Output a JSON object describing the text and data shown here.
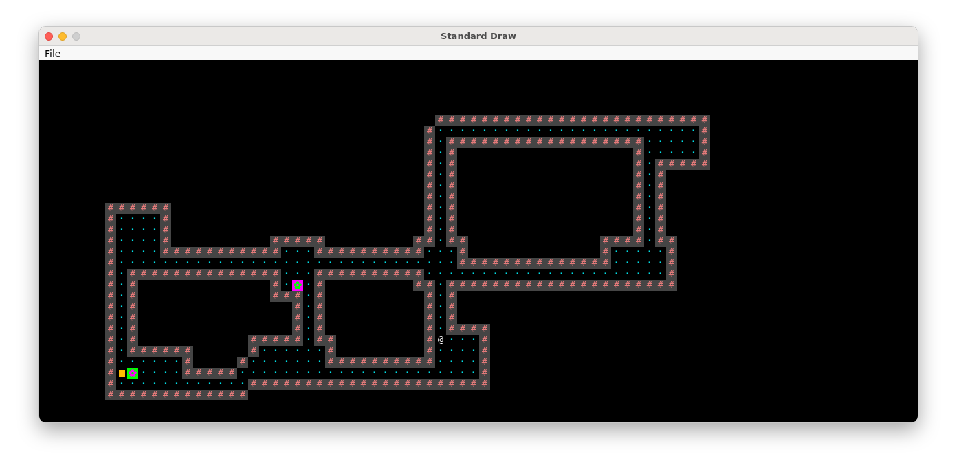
{
  "window": {
    "title": "Standard Draw"
  },
  "menu": [
    "File"
  ],
  "map_rows": [
    [
      {
        "kind": "gap",
        "text": "                              "
      },
      {
        "kind": "wall",
        "text": "# # # # # # # # # # # # # # # # # # # # # # # # #"
      }
    ],
    [
      {
        "kind": "gap",
        "text": "                             "
      },
      {
        "kind": "wall",
        "text": "#"
      },
      {
        "kind": "floor",
        "text": "· · · · · · · · · · · · · · · · · · · · · · · ·"
      },
      {
        "kind": "wall",
        "text": "#"
      }
    ],
    [
      {
        "kind": "gap",
        "text": "                             "
      },
      {
        "kind": "wall",
        "text": "#"
      },
      {
        "kind": "floor",
        "text": "·"
      },
      {
        "kind": "wall",
        "text": "# # # # # # # # # # # # # # # # # #"
      },
      {
        "kind": "floor",
        "text": "· · · · ·"
      },
      {
        "kind": "wall",
        "text": "#"
      }
    ],
    [
      {
        "kind": "gap",
        "text": "                             "
      },
      {
        "kind": "wall",
        "text": "#"
      },
      {
        "kind": "floor",
        "text": "·"
      },
      {
        "kind": "wall",
        "text": "#"
      },
      {
        "kind": "gap",
        "text": "                "
      },
      {
        "kind": "wall",
        "text": "#"
      },
      {
        "kind": "floor",
        "text": "· · · · ·"
      },
      {
        "kind": "wall",
        "text": "#"
      }
    ],
    [
      {
        "kind": "gap",
        "text": "                             "
      },
      {
        "kind": "wall",
        "text": "#"
      },
      {
        "kind": "floor",
        "text": "·"
      },
      {
        "kind": "wall",
        "text": "#"
      },
      {
        "kind": "gap",
        "text": "                "
      },
      {
        "kind": "wall",
        "text": "#"
      },
      {
        "kind": "floor",
        "text": "·"
      },
      {
        "kind": "wall",
        "text": "# # # # #"
      }
    ],
    [
      {
        "kind": "gap",
        "text": "                             "
      },
      {
        "kind": "wall",
        "text": "#"
      },
      {
        "kind": "floor",
        "text": "·"
      },
      {
        "kind": "wall",
        "text": "#"
      },
      {
        "kind": "gap",
        "text": "                "
      },
      {
        "kind": "wall",
        "text": "#"
      },
      {
        "kind": "floor",
        "text": "·"
      },
      {
        "kind": "wall",
        "text": "#"
      }
    ],
    [
      {
        "kind": "gap",
        "text": "                             "
      },
      {
        "kind": "wall",
        "text": "#"
      },
      {
        "kind": "floor",
        "text": "·"
      },
      {
        "kind": "wall",
        "text": "#"
      },
      {
        "kind": "gap",
        "text": "                "
      },
      {
        "kind": "wall",
        "text": "#"
      },
      {
        "kind": "floor",
        "text": "·"
      },
      {
        "kind": "wall",
        "text": "#"
      }
    ],
    [
      {
        "kind": "gap",
        "text": "                             "
      },
      {
        "kind": "wall",
        "text": "#"
      },
      {
        "kind": "floor",
        "text": "·"
      },
      {
        "kind": "wall",
        "text": "#"
      },
      {
        "kind": "gap",
        "text": "                "
      },
      {
        "kind": "wall",
        "text": "#"
      },
      {
        "kind": "floor",
        "text": "·"
      },
      {
        "kind": "wall",
        "text": "#"
      }
    ],
    [
      {
        "kind": "wall",
        "text": "# # # # # #"
      },
      {
        "kind": "gap",
        "text": "                       "
      },
      {
        "kind": "wall",
        "text": "#"
      },
      {
        "kind": "floor",
        "text": "·"
      },
      {
        "kind": "wall",
        "text": "#"
      },
      {
        "kind": "gap",
        "text": "                "
      },
      {
        "kind": "wall",
        "text": "#"
      },
      {
        "kind": "floor",
        "text": "·"
      },
      {
        "kind": "wall",
        "text": "#"
      }
    ],
    [
      {
        "kind": "wall",
        "text": "#"
      },
      {
        "kind": "floor",
        "text": "· · · ·"
      },
      {
        "kind": "wall",
        "text": "#"
      },
      {
        "kind": "gap",
        "text": "                       "
      },
      {
        "kind": "wall",
        "text": "#"
      },
      {
        "kind": "floor",
        "text": "·"
      },
      {
        "kind": "wall",
        "text": "#"
      },
      {
        "kind": "gap",
        "text": "                "
      },
      {
        "kind": "wall",
        "text": "#"
      },
      {
        "kind": "floor",
        "text": "·"
      },
      {
        "kind": "wall",
        "text": "#"
      }
    ],
    [
      {
        "kind": "wall",
        "text": "#"
      },
      {
        "kind": "floor",
        "text": "· · · ·"
      },
      {
        "kind": "wall",
        "text": "#"
      },
      {
        "kind": "gap",
        "text": "                       "
      },
      {
        "kind": "wall",
        "text": "#"
      },
      {
        "kind": "floor",
        "text": "·"
      },
      {
        "kind": "wall",
        "text": "#"
      },
      {
        "kind": "gap",
        "text": "                "
      },
      {
        "kind": "wall",
        "text": "#"
      },
      {
        "kind": "floor",
        "text": "·"
      },
      {
        "kind": "wall",
        "text": "#"
      }
    ],
    [
      {
        "kind": "wall",
        "text": "#"
      },
      {
        "kind": "floor",
        "text": "· · · ·"
      },
      {
        "kind": "wall",
        "text": "#"
      },
      {
        "kind": "gap",
        "text": "         "
      },
      {
        "kind": "wall",
        "text": "# # # # #"
      },
      {
        "kind": "gap",
        "text": "        "
      },
      {
        "kind": "wall",
        "text": "# #"
      },
      {
        "kind": "floor",
        "text": "·"
      },
      {
        "kind": "wall",
        "text": "# #"
      },
      {
        "kind": "gap",
        "text": "            "
      },
      {
        "kind": "wall",
        "text": "# # # #"
      },
      {
        "kind": "floor",
        "text": "·"
      },
      {
        "kind": "wall",
        "text": "# #"
      }
    ],
    [
      {
        "kind": "wall",
        "text": "#"
      },
      {
        "kind": "floor",
        "text": "· · · ·"
      },
      {
        "kind": "wall",
        "text": "# # # # # # # # # # #"
      },
      {
        "kind": "floor",
        "text": "· · ·"
      },
      {
        "kind": "wall",
        "text": "# # # # # # # # # #"
      },
      {
        "kind": "floor",
        "text": "· · ·"
      },
      {
        "kind": "wall",
        "text": "#"
      },
      {
        "kind": "gap",
        "text": "            "
      },
      {
        "kind": "wall",
        "text": "#"
      },
      {
        "kind": "floor",
        "text": "· · · · ·"
      },
      {
        "kind": "wall",
        "text": "#"
      }
    ],
    [
      {
        "kind": "wall",
        "text": "#"
      },
      {
        "kind": "floor",
        "text": "· · · · · · · · · · · · · · · · · · · · · · · · · · · · · · ·"
      },
      {
        "kind": "wall",
        "text": "# # # # # # # # # # # # # #"
      },
      {
        "kind": "floor",
        "text": "· · · · ·"
      },
      {
        "kind": "wall",
        "text": "#"
      }
    ],
    [
      {
        "kind": "wall",
        "text": "#"
      },
      {
        "kind": "floor",
        "text": "·"
      },
      {
        "kind": "wall",
        "text": "# # # # # # # # # # # # # #"
      },
      {
        "kind": "floor",
        "text": "· · ·"
      },
      {
        "kind": "wall",
        "text": "# # # # # # # # # #"
      },
      {
        "kind": "floor",
        "text": "· · · · · · · · · · · · · · · · · · · · · ·"
      },
      {
        "kind": "wall",
        "text": "#"
      }
    ],
    [
      {
        "kind": "wall",
        "text": "#"
      },
      {
        "kind": "floor",
        "text": "·"
      },
      {
        "kind": "wall",
        "text": "#"
      },
      {
        "kind": "gap",
        "text": "            "
      },
      {
        "kind": "wall",
        "text": "#"
      },
      {
        "kind": "floor",
        "text": "·"
      },
      {
        "kind": "monster",
        "color": "#ff00ff"
      },
      {
        "kind": "floor",
        "text": "·"
      },
      {
        "kind": "wall",
        "text": "#"
      },
      {
        "kind": "gap",
        "text": "        "
      },
      {
        "kind": "wall",
        "text": "# #"
      },
      {
        "kind": "floor",
        "text": "·"
      },
      {
        "kind": "wall",
        "text": "# # # # # # # # # # # # # # # # # # # # #"
      }
    ],
    [
      {
        "kind": "wall",
        "text": "#"
      },
      {
        "kind": "floor",
        "text": "·"
      },
      {
        "kind": "wall",
        "text": "#"
      },
      {
        "kind": "gap",
        "text": "            "
      },
      {
        "kind": "wall",
        "text": "# # #"
      },
      {
        "kind": "floor",
        "text": "·"
      },
      {
        "kind": "wall",
        "text": "#"
      },
      {
        "kind": "gap",
        "text": "         "
      },
      {
        "kind": "wall",
        "text": "#"
      },
      {
        "kind": "floor",
        "text": "·"
      },
      {
        "kind": "wall",
        "text": "#"
      }
    ],
    [
      {
        "kind": "wall",
        "text": "#"
      },
      {
        "kind": "floor",
        "text": "·"
      },
      {
        "kind": "wall",
        "text": "#"
      },
      {
        "kind": "gap",
        "text": "              "
      },
      {
        "kind": "wall",
        "text": "#"
      },
      {
        "kind": "floor",
        "text": "·"
      },
      {
        "kind": "wall",
        "text": "#"
      },
      {
        "kind": "gap",
        "text": "         "
      },
      {
        "kind": "wall",
        "text": "#"
      },
      {
        "kind": "floor",
        "text": "·"
      },
      {
        "kind": "wall",
        "text": "#"
      }
    ],
    [
      {
        "kind": "wall",
        "text": "#"
      },
      {
        "kind": "floor",
        "text": "·"
      },
      {
        "kind": "wall",
        "text": "#"
      },
      {
        "kind": "gap",
        "text": "              "
      },
      {
        "kind": "wall",
        "text": "#"
      },
      {
        "kind": "floor",
        "text": "·"
      },
      {
        "kind": "wall",
        "text": "#"
      },
      {
        "kind": "gap",
        "text": "         "
      },
      {
        "kind": "wall",
        "text": "#"
      },
      {
        "kind": "floor",
        "text": "·"
      },
      {
        "kind": "wall",
        "text": "#"
      }
    ],
    [
      {
        "kind": "wall",
        "text": "#"
      },
      {
        "kind": "floor",
        "text": "·"
      },
      {
        "kind": "wall",
        "text": "#"
      },
      {
        "kind": "gap",
        "text": "              "
      },
      {
        "kind": "wall",
        "text": "#"
      },
      {
        "kind": "floor",
        "text": "·"
      },
      {
        "kind": "wall",
        "text": "#"
      },
      {
        "kind": "gap",
        "text": "         "
      },
      {
        "kind": "wall",
        "text": "#"
      },
      {
        "kind": "floor",
        "text": "·"
      },
      {
        "kind": "wall",
        "text": "# # # #"
      }
    ],
    [
      {
        "kind": "wall",
        "text": "#"
      },
      {
        "kind": "floor",
        "text": "·"
      },
      {
        "kind": "wall",
        "text": "#"
      },
      {
        "kind": "gap",
        "text": "          "
      },
      {
        "kind": "wall",
        "text": "# # # # #"
      },
      {
        "kind": "floor",
        "text": "·"
      },
      {
        "kind": "wall",
        "text": "# #"
      },
      {
        "kind": "gap",
        "text": "        "
      },
      {
        "kind": "wall",
        "text": "#"
      },
      {
        "kind": "player",
        "text": "@"
      },
      {
        "kind": "floor",
        "text": "· · ·"
      },
      {
        "kind": "wall",
        "text": "#"
      }
    ],
    [
      {
        "kind": "wall",
        "text": "#"
      },
      {
        "kind": "floor",
        "text": "·"
      },
      {
        "kind": "wall",
        "text": "# # # # # #"
      },
      {
        "kind": "gap",
        "text": "     "
      },
      {
        "kind": "wall",
        "text": "#"
      },
      {
        "kind": "floor",
        "text": "· · · · · ·"
      },
      {
        "kind": "wall",
        "text": "#"
      },
      {
        "kind": "gap",
        "text": "        "
      },
      {
        "kind": "wall",
        "text": "#"
      },
      {
        "kind": "floor",
        "text": "· · · ·"
      },
      {
        "kind": "wall",
        "text": "#"
      }
    ],
    [
      {
        "kind": "wall",
        "text": "#"
      },
      {
        "kind": "floor",
        "text": "· · · · · ·"
      },
      {
        "kind": "wall",
        "text": "#"
      },
      {
        "kind": "gap",
        "text": "    "
      },
      {
        "kind": "wall",
        "text": "#"
      },
      {
        "kind": "floor",
        "text": "· · · · · · ·"
      },
      {
        "kind": "wall",
        "text": "# # # # # # # # # #"
      },
      {
        "kind": "floor",
        "text": "· · · ·"
      },
      {
        "kind": "wall",
        "text": "#"
      }
    ],
    [
      {
        "kind": "wall",
        "text": "#"
      },
      {
        "kind": "item",
        "color": "#ffc000"
      },
      {
        "kind": "monster",
        "color": "#00ff00"
      },
      {
        "kind": "floor",
        "text": "· · · ·"
      },
      {
        "kind": "wall",
        "text": "# # # # #"
      },
      {
        "kind": "floor",
        "text": "· · · · · · · · · · · · · · · · · · · · · ·"
      },
      {
        "kind": "wall",
        "text": "#"
      }
    ],
    [
      {
        "kind": "wall",
        "text": "#"
      },
      {
        "kind": "floor",
        "text": "· · · · · · · · · · · ·"
      },
      {
        "kind": "wall",
        "text": "# # # # # # # # # # # # # # # # # # # # # #"
      }
    ],
    [
      {
        "kind": "wall",
        "text": "# # # # # # # # # # # # #"
      }
    ]
  ]
}
